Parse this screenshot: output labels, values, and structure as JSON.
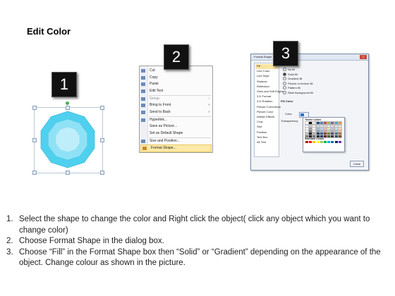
{
  "title": "Edit Color",
  "markers": [
    "1",
    "2",
    "3"
  ],
  "context_menu": {
    "items": [
      {
        "label": "Cut",
        "icon": "scissors-icon"
      },
      {
        "label": "Copy",
        "icon": "copy-icon"
      },
      {
        "label": "Paste",
        "icon": "paste-icon"
      },
      {
        "label": "Edit Text",
        "icon": "edit-text-icon"
      },
      {
        "label": "Group",
        "icon": "group-icon",
        "submenu": true,
        "disabled": true
      },
      {
        "label": "Bring to Front",
        "icon": "bring-front-icon",
        "submenu": true
      },
      {
        "label": "Send to Back",
        "icon": "send-back-icon",
        "submenu": true
      },
      {
        "label": "Hyperlink...",
        "icon": "hyperlink-icon"
      },
      {
        "label": "Save as Picture...",
        "icon": ""
      },
      {
        "label": "Set as Default Shape",
        "icon": ""
      },
      {
        "label": "Size and Position...",
        "icon": "size-position-icon"
      },
      {
        "label": "Format Shape...",
        "icon": "format-shape-icon",
        "highlighted": true
      }
    ],
    "submenu_arrow": "›"
  },
  "dialog": {
    "title": "Format Shape",
    "close_glyph": "x",
    "categories": [
      "Fill",
      "Line Color",
      "Line Style",
      "Shadow",
      "Reflection",
      "Glow and Soft Edges",
      "3-D Format",
      "3-D Rotation",
      "Picture Corrections",
      "Picture Color",
      "Artistic Effects",
      "Crop",
      "Size",
      "Position",
      "Text Box",
      "Alt Text"
    ],
    "active_category": "Fill",
    "section_label": "Fill",
    "fill_options": [
      {
        "label": "No fill",
        "selected": false
      },
      {
        "label": "Solid fill",
        "selected": true
      },
      {
        "label": "Gradient fill",
        "selected": false
      },
      {
        "label": "Picture or texture fill",
        "selected": false
      },
      {
        "label": "Pattern fill",
        "selected": false
      },
      {
        "label": "Slide background fill",
        "selected": false
      }
    ],
    "fill_color_label": "Fill Color",
    "color_label": "Color:",
    "transparency_label": "Transparency:",
    "theme_colors_label": "Theme Colors",
    "standard_colors_label": "Standard Colors",
    "close_button": "Close",
    "accent_color": "#3070c0",
    "theme_columns": [
      "#ffffff",
      "#000000",
      "#eeece1",
      "#1f497d",
      "#4f81bd",
      "#c0504d",
      "#9bbb59",
      "#8064a2",
      "#4bacc6",
      "#f79646"
    ],
    "standard_colors": [
      "#c00000",
      "#ff0000",
      "#ffc000",
      "#ffff00",
      "#92d050",
      "#00b050",
      "#00b0f0",
      "#0070c0",
      "#002060",
      "#7030a0"
    ]
  },
  "shape": {
    "outer_color": "#4fd0ee",
    "middle_color": "#8fe2f5",
    "inner_color": "#bdeefa"
  },
  "steps": [
    {
      "num": "1.",
      "text": "Select the shape to change the color and Right click the object( click any object which you want to change color)"
    },
    {
      "num": "2.",
      "text": "Choose Format Shape in the dialog box."
    },
    {
      "num": "3.",
      "text": "Choose “Fill” in the Format Shape box then “Solid” or “Gradient” depending on the appearance of the object. Change colour as shown in the picture."
    }
  ]
}
